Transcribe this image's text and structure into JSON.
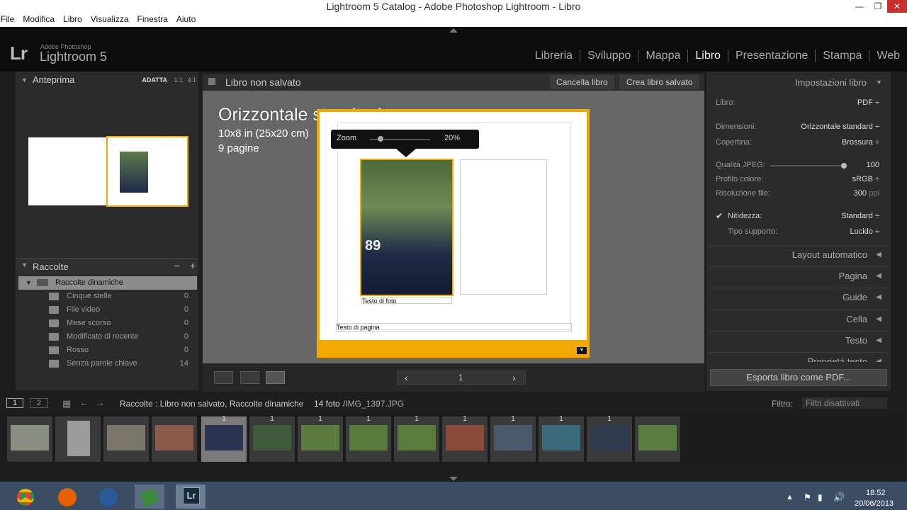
{
  "window": {
    "title": "Lightroom 5 Catalog - Adobe Photoshop Lightroom - Libro"
  },
  "menu": [
    "File",
    "Modifica",
    "Libro",
    "Visualizza",
    "Finestra",
    "Aiuto"
  ],
  "logo": {
    "mark": "Lr",
    "small": "Adobe Photoshop",
    "name": "Lightroom 5"
  },
  "modules": [
    "Libreria",
    "Sviluppo",
    "Mappa",
    "Libro",
    "Presentazione",
    "Stampa",
    "Web"
  ],
  "active_module": "Libro",
  "left": {
    "preview": {
      "label": "Anteprima",
      "adatta": "ADATTA",
      "z1": "1:1",
      "z4": "4:1"
    },
    "collections": {
      "label": "Raccolte",
      "minus": "−",
      "plus": "+",
      "group": "Raccolte dinamiche",
      "items": [
        {
          "name": "Cinque stelle",
          "count": "0"
        },
        {
          "name": "File video",
          "count": "0"
        },
        {
          "name": "Mese scorso",
          "count": "0"
        },
        {
          "name": "Modificato di recente",
          "count": "0"
        },
        {
          "name": "Rosso",
          "count": "0"
        },
        {
          "name": "Senza parole chiave",
          "count": "14"
        }
      ]
    }
  },
  "center": {
    "title": "Libro non salvato",
    "btn_clear": "Cancella libro",
    "btn_create": "Crea libro salvato",
    "book_type": "Orizzontale standard",
    "book_size": "10x8 in (25x20 cm)",
    "book_pages": "9 pagine",
    "zoom_label": "Zoom",
    "zoom_value": "20%",
    "photo_caption": "Testo di foto",
    "page_caption": "Testo di pagina",
    "page_num": "1",
    "prev": "‹",
    "next": "›"
  },
  "right": {
    "head": "Impostazioni libro",
    "libro_label": "Libro:",
    "libro_val": "PDF ÷",
    "dim_label": "Dimensioni:",
    "dim_val": "Orizzontale standard ÷",
    "cop_label": "Copertina:",
    "cop_val": "Brossura ÷",
    "jpeg_label": "Qualità JPEG:",
    "jpeg_val": "100",
    "prof_label": "Profilo colore:",
    "prof_val": "sRGB ÷",
    "ris_label": "Risoluzione file:",
    "ris_val": "300",
    "ris_unit": "ppi",
    "nit_label": "Nitidezza:",
    "nit_val": "Standard ÷",
    "sup_label": "Tipo supporto:",
    "sup_val": "Lucido ÷",
    "sections": [
      "Layout automatico",
      "Pagina",
      "Guide",
      "Cella",
      "Testo",
      "Proprietà testo"
    ],
    "export": "Esporta libro come PDF..."
  },
  "filmbar": {
    "view1": "1",
    "view2": "2",
    "path": "Raccolte : Libro non salvato, Raccolte dinamiche",
    "count": "14 foto",
    "file": "/IMG_1397.JPG",
    "filter_label": "Filtro:",
    "filter_val": "Filtri disattivati"
  },
  "filmstrip": {
    "badges": [
      "",
      "",
      "",
      "",
      "1",
      "1",
      "1",
      "1",
      "1",
      "1",
      "1",
      "1",
      "1",
      ""
    ]
  },
  "taskbar": {
    "time": "18.52",
    "date": "20/06/2013"
  },
  "colors": {
    "accent": "#f2a900",
    "bg": "#676767"
  }
}
